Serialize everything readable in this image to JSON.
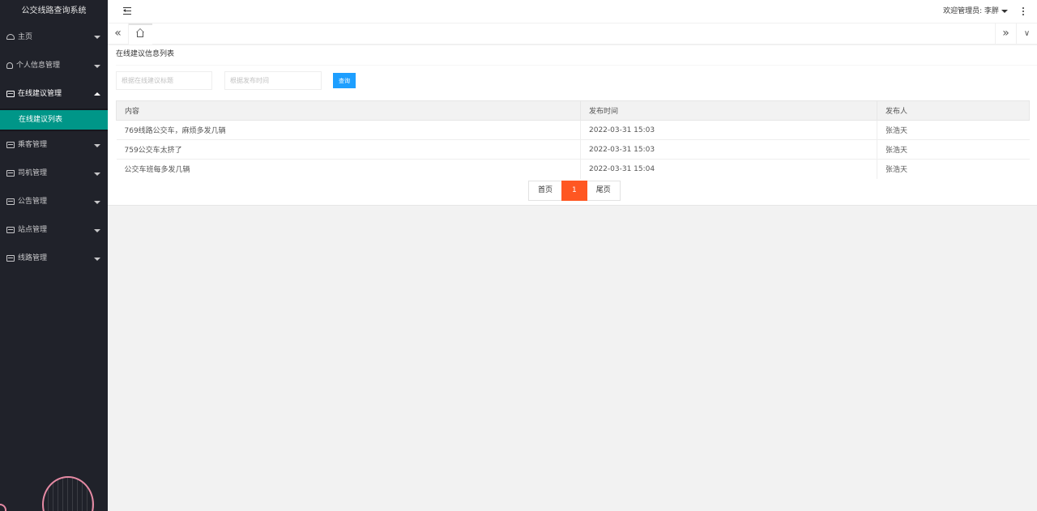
{
  "sidebar": {
    "title": "公交线路查询系统",
    "items": [
      {
        "label": "主页",
        "icon": "home-icon"
      },
      {
        "label": "个人信息管理",
        "icon": "user-icon"
      },
      {
        "label": "在线建议管理",
        "icon": "list-icon",
        "children": [
          {
            "label": "在线建议列表"
          }
        ]
      },
      {
        "label": "乘客管理",
        "icon": "list-icon"
      },
      {
        "label": "司机管理",
        "icon": "list-icon"
      },
      {
        "label": "公告管理",
        "icon": "list-icon"
      },
      {
        "label": "站点管理",
        "icon": "list-icon"
      },
      {
        "label": "线路管理",
        "icon": "list-icon"
      }
    ]
  },
  "header": {
    "welcome": "欢迎管理员: 李胖"
  },
  "page": {
    "title": "在线建议信息列表"
  },
  "search": {
    "title_placeholder": "根据在线建议标题",
    "time_placeholder": "根据发布时间",
    "button": "查询"
  },
  "table": {
    "columns": [
      "内容",
      "发布时间",
      "发布人"
    ],
    "rows": [
      [
        "769线路公交车，麻烦多发几辆",
        "2022-03-31 15:03",
        "张浩天"
      ],
      [
        "759公交车太挤了",
        "2022-03-31 15:03",
        "张浩天"
      ],
      [
        "公交车班每多发几辆",
        "2022-03-31 15:04",
        "张浩天"
      ]
    ]
  },
  "pager": {
    "first": "首页",
    "current": "1",
    "last": "尾页"
  },
  "colors": {
    "sidebar_bg": "#20222a",
    "active_item": "#009688",
    "primary_button": "#1e9fff",
    "current_page": "#ff5722"
  }
}
